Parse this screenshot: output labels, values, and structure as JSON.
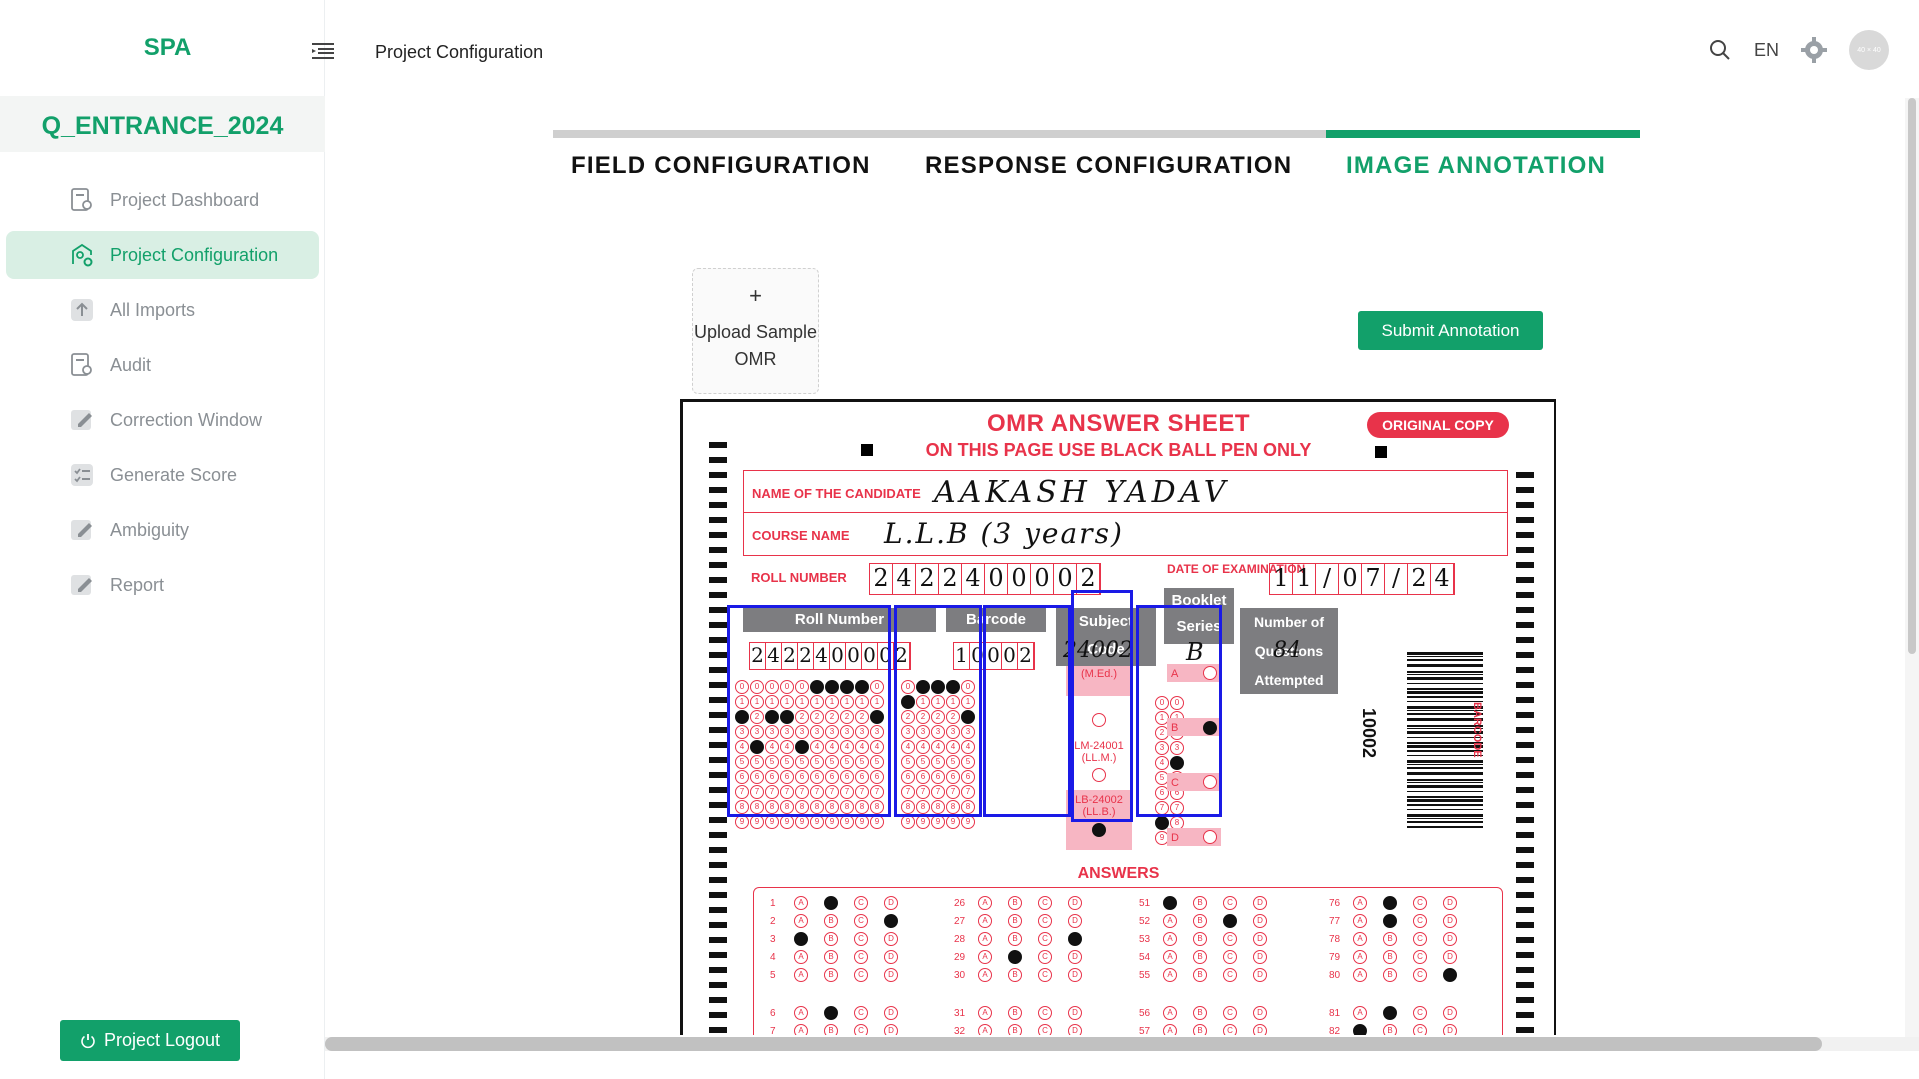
{
  "app": {
    "brand": "SPA",
    "page_title": "Project Configuration"
  },
  "sidebar": {
    "project_name": "Q_ENTRANCE_2024",
    "items": [
      {
        "label": "Project Dashboard",
        "icon": "dashboard-icon"
      },
      {
        "label": "Project Configuration",
        "icon": "config-icon",
        "active": true
      },
      {
        "label": "All Imports",
        "icon": "import-icon"
      },
      {
        "label": "Audit",
        "icon": "audit-icon"
      },
      {
        "label": "Correction Window",
        "icon": "edit-icon"
      },
      {
        "label": "Generate Score",
        "icon": "checklist-icon"
      },
      {
        "label": "Ambiguity",
        "icon": "edit-icon"
      },
      {
        "label": "Report",
        "icon": "edit-icon"
      }
    ],
    "logout_label": "Project Logout"
  },
  "topbar": {
    "language": "EN",
    "avatar_text": "40 × 40"
  },
  "steps": [
    {
      "label": "FIELD CONFIGURATION"
    },
    {
      "label": "RESPONSE CONFIGURATION"
    },
    {
      "label": "IMAGE ANNOTATION",
      "active": true
    }
  ],
  "upload": {
    "plus": "+",
    "label": "Upload Sample OMR"
  },
  "submit_label": "Submit Annotation",
  "omr": {
    "title": "OMR ANSWER SHEET",
    "subtitle": "ON THIS PAGE USE BLACK BALL PEN ONLY",
    "original_copy": "ORIGINAL COPY",
    "name_label": "NAME OF THE CANDIDATE",
    "name_value": "AAKASH  YADAV",
    "course_label": "COURSE NAME",
    "course_value": "L.L.B (3 years)",
    "roll_label": "ROLL NUMBER",
    "roll_digits": [
      "2",
      "4",
      "2",
      "2",
      "4",
      "0",
      "0",
      "0",
      "0",
      "2"
    ],
    "dob_label": "DATE OF EXAMINATION",
    "dob_digits": [
      "1",
      "1",
      "/",
      "0",
      "7",
      "/",
      "2",
      "4"
    ],
    "booklet_digits": [
      "1",
      "0",
      "0",
      "0",
      "2"
    ],
    "subject_code_value": "24002",
    "booklet_series_value": "B",
    "questions_attempted_value": "84",
    "subject_options": [
      "MD-24003 (M.Ed.)",
      "LM-24001 (LL.M.)",
      "LB-24002 (LL.B.)"
    ],
    "series_options": [
      "A",
      "B",
      "C",
      "D"
    ],
    "barcode_number": "10002",
    "barcode_label": "BARCODE",
    "answers_title": "ANSWERS",
    "answer_numbers": [
      [
        "1",
        "2",
        "3",
        "4",
        "5",
        "6",
        "7"
      ],
      [
        "26",
        "27",
        "28",
        "29",
        "30",
        "31",
        "32"
      ],
      [
        "51",
        "52",
        "53",
        "54",
        "55",
        "56",
        "57"
      ],
      [
        "76",
        "77",
        "78",
        "79",
        "80",
        "81",
        "82"
      ]
    ]
  },
  "annotations": [
    {
      "label": "Roll Number"
    },
    {
      "label": "Barcode"
    },
    {
      "label": "Subject Code"
    },
    {
      "label": "Booklet Series"
    },
    {
      "label": "Number of Questions Attempted"
    }
  ]
}
